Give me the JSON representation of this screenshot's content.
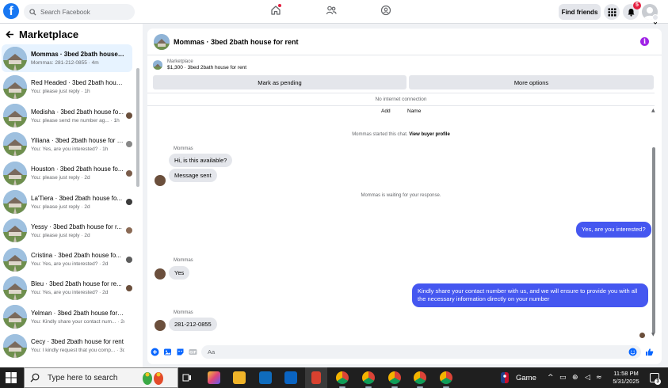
{
  "topbar": {
    "logo": "f",
    "search_placeholder": "Search Facebook",
    "find_friends": "Find friends",
    "notifications_count": "5"
  },
  "sidebar": {
    "title": "Marketplace",
    "conversations": [
      {
        "name": "Mommas · 3bed 2bath house fo...",
        "preview": "Mommas: 281-212-0855 · 4m",
        "active": true
      },
      {
        "name": "Red Headed · 3bed 2bath house...",
        "preview": "You: please just reply · 1h"
      },
      {
        "name": "Medisha · 3bed 2bath house fo...",
        "preview": "You: please send me number ag... · 1h"
      },
      {
        "name": "Yiliana · 3bed 2bath house for re...",
        "preview": "You: Yes, are you interested? · 1h"
      },
      {
        "name": "Houston · 3bed 2bath house fo...",
        "preview": "You: please just reply · 2d"
      },
      {
        "name": "La'Tiera · 3bed 2bath house fo...",
        "preview": "You: please just reply · 2d"
      },
      {
        "name": "Yessy · 3bed 2bath house for r...",
        "preview": "You: please just reply · 2d"
      },
      {
        "name": "Cristina · 3bed 2bath house fo...",
        "preview": "You: Yes, are you interested? · 2d"
      },
      {
        "name": "Bleu · 3bed 2bath house for re...",
        "preview": "You: Yes, are you interested? · 2d"
      },
      {
        "name": "Yelman · 3bed 2bath house for r...",
        "preview": "You: Kindly share your contact num... · 2d"
      },
      {
        "name": "Cecy · 3bed 2bath house for rent",
        "preview": "You: I kindly request that you comp... · 3d"
      }
    ]
  },
  "chat": {
    "title": "Mommas · 3bed 2bath house for rent",
    "listing_source": "Marketplace",
    "listing_detail": "$1,300 · 3bed 2bath house for rent",
    "mark_pending": "Mark as pending",
    "more_options": "More options",
    "no_connection": "No internet connection",
    "tab_add": "Add",
    "tab_name": "Name",
    "started_text": "Mommas started this chat.",
    "buyer_profile": "View buyer profile",
    "waiting_text": "Mommas is waiting for your response.",
    "sender": "Mommas",
    "msg_available": "Hi, is this available?",
    "msg_sent": "Message sent",
    "msg_interested": "Yes, are you interested?",
    "msg_yes": "Yes",
    "msg_kindly": "Kindly share your contact number with us, and we will ensure to provide you with all the necessary information directly on your number",
    "msg_phone": "281-212-0855",
    "composer_placeholder": "Aa"
  },
  "taskbar": {
    "search_text": "Type here to search",
    "game_label": "Game",
    "time": "11:58 PM",
    "date": "5/31/2025",
    "notif_count": "3"
  },
  "colors": {
    "fb_blue": "#1877f2",
    "outgoing_bubble": "#4557f0",
    "info_purple": "#a023e6",
    "badge_red": "#e41e3f"
  }
}
